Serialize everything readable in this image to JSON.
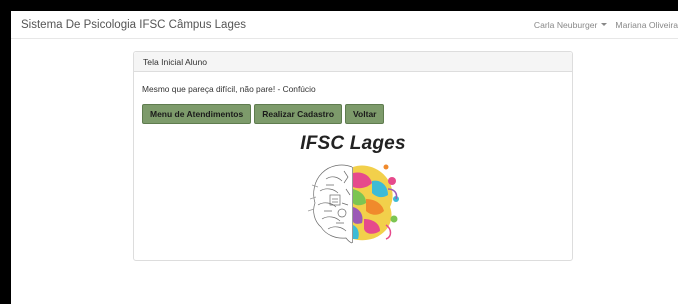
{
  "navbar": {
    "brand": "Sistema De Psicologia IFSC Câmpus Lages",
    "user_menu": "Carla Neuburger",
    "user2": "Mariana Oliveira"
  },
  "panel": {
    "heading": "Tela Inicial Aluno",
    "quote": "Mesmo que pareça difícil, não pare! - Confúcio",
    "buttons": {
      "menu": "Menu de Atendimentos",
      "cadastro": "Realizar Cadastro",
      "voltar": "Voltar"
    },
    "title": "IFSC Lages",
    "image_name": "brain-illustration"
  },
  "colors": {
    "button_bg": "#7d9b6b",
    "panel_heading_bg": "#f5f5f5"
  }
}
